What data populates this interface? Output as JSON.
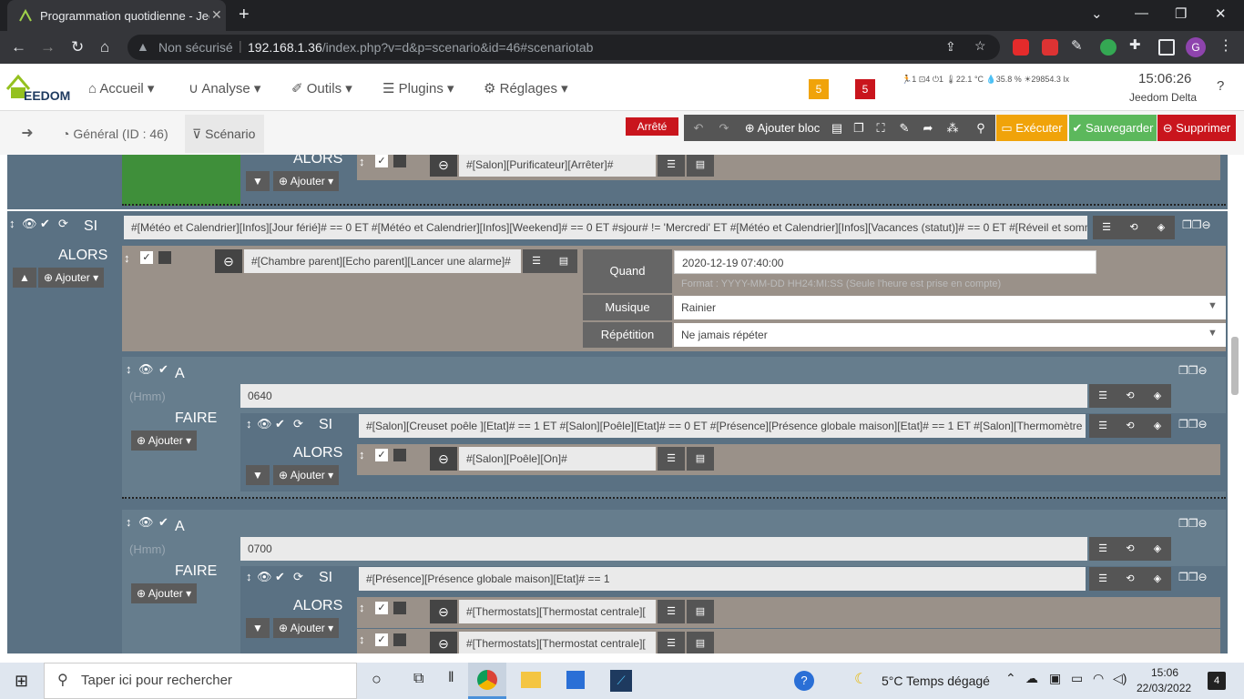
{
  "browser": {
    "tab_title": "Programmation quotidienne - Jeedom",
    "tab_close": "✕",
    "new_tab": "+",
    "security_label": "Non sécurisé",
    "url_host": "192.168.1.36",
    "url_path": "/index.php?v=d&p=scenario&id=46#scenariotab",
    "profile_initial": "G"
  },
  "navbar": {
    "menus": [
      "Accueil",
      "Analyse",
      "Outils",
      "Plugins",
      "Réglages"
    ],
    "badge_orange": "5",
    "badge_red": "5",
    "sensors": [
      "1",
      "4",
      "1",
      "22.1 °C",
      "35.8 %",
      "29854.3 lx"
    ],
    "time": "15:06:26",
    "hostname": "Jeedom Delta"
  },
  "toolbar": {
    "tab_general": "Général (ID : 46)",
    "tab_scenario": "Scénario",
    "status": "Arrêté",
    "add_block": "Ajouter bloc",
    "execute": "Exécuter",
    "save": "Sauvegarder",
    "delete": "Supprimer"
  },
  "scenario": {
    "top_block": {
      "alors": "ALORS",
      "add": "Ajouter",
      "action": "#[Salon][Purificateur][Arrêter]#"
    },
    "si_block": {
      "si": "SI",
      "condition": "#[Météo et Calendrier][Infos][Jour férié]# == 0 ET #[Météo et Calendrier][Infos][Weekend]# == 0 ET #sjour# != 'Mercredi' ET #[Météo et Calendrier][Infos][Vacances (statut)]# == 0 ET #[Réveil et sommeil]",
      "alors": "ALORS",
      "add": "Ajouter",
      "action": "#[Chambre parent][Echo parent][Lancer une alarme]#",
      "opt_quand_label": "Quand",
      "opt_quand_value": "2020-12-19 07:40:00",
      "opt_format_hint": "Format : YYYY-MM-DD HH24:MI:SS (Seule l'heure est prise en compte)",
      "opt_musique_label": "Musique",
      "opt_musique_value": "Rainier",
      "opt_repetition_label": "Répétition",
      "opt_repetition_value": "Ne jamais répéter"
    },
    "a_block_1": {
      "a": "A",
      "hmm": "(Hmm)",
      "time": "0640",
      "faire": "FAIRE",
      "add": "Ajouter",
      "si": "SI",
      "condition": "#[Salon][Creuset poêle ][Etat]# == 1 ET #[Salon][Poêle][Etat]# == 0 ET #[Présence][Présence globale maison][Etat]# == 1 ET #[Salon][Thermomètre",
      "alors": "ALORS",
      "add2": "Ajouter",
      "action": "#[Salon][Poêle][On]#"
    },
    "a_block_2": {
      "a": "A",
      "hmm": "(Hmm)",
      "time": "0700",
      "faire": "FAIRE",
      "add": "Ajouter",
      "si": "SI",
      "condition": "#[Présence][Présence globale maison][Etat]# == 1",
      "alors": "ALORS",
      "add2": "Ajouter",
      "action1": "#[Thermostats][Thermostat centrale][",
      "action2": "#[Thermostats][Thermostat centrale]["
    }
  },
  "taskbar": {
    "search_placeholder": "Taper ici pour rechercher",
    "weather": "5°C  Temps dégagé",
    "time": "15:06",
    "date": "22/03/2022",
    "notif_count": "4"
  }
}
